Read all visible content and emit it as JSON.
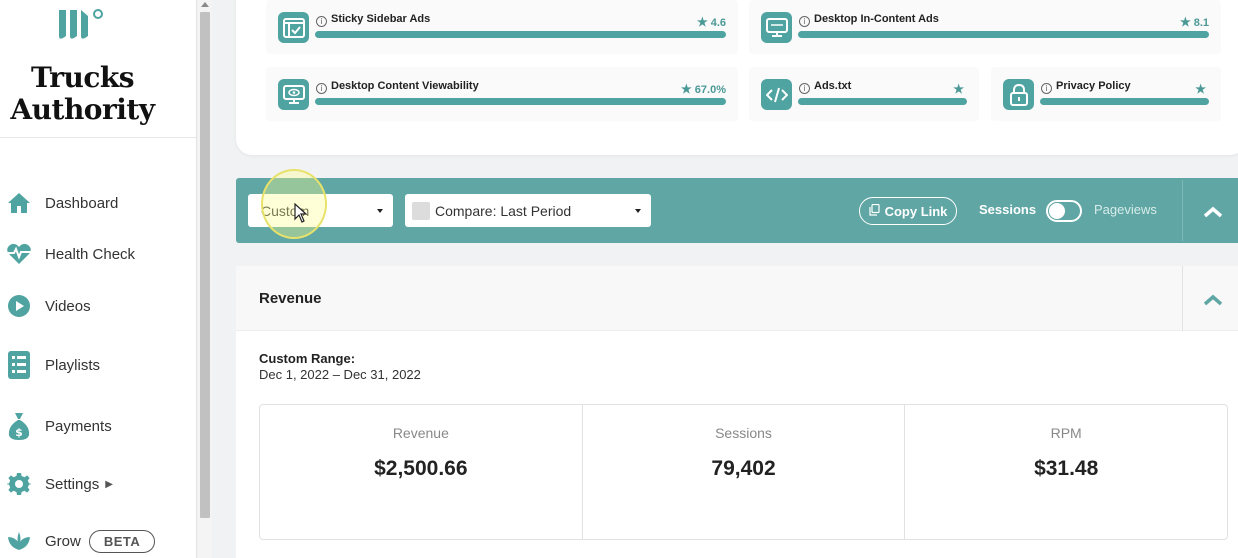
{
  "brand": {
    "line1": "Trucks",
    "line2": "Authority"
  },
  "sidebar": {
    "items": [
      {
        "label": "Dashboard",
        "icon": "home-icon"
      },
      {
        "label": "Health Check",
        "icon": "heartbeat-icon"
      },
      {
        "label": "Videos",
        "icon": "play-icon"
      },
      {
        "label": "Playlists",
        "icon": "list-icon"
      },
      {
        "label": "Payments",
        "icon": "money-bag-icon"
      },
      {
        "label": "Settings",
        "icon": "gear-icon"
      },
      {
        "label": "Grow",
        "icon": "leaf-icon",
        "badge": "BETA"
      }
    ]
  },
  "metrics": [
    {
      "title": "Sticky Sidebar Ads",
      "score": "4.6",
      "icon": "sidebar-window-icon"
    },
    {
      "title": "Desktop In-Content Ads",
      "score": "8.1",
      "icon": "desktop-monitor-icon"
    },
    {
      "title": "Desktop Content Viewability",
      "score": "67.0%",
      "icon": "monitor-eye-icon"
    },
    {
      "title": "Ads.txt",
      "score": "",
      "icon": "code-icon"
    },
    {
      "title": "Privacy Policy",
      "score": "",
      "icon": "lock-icon"
    }
  ],
  "filters": {
    "range_value": "Custom",
    "compare_value": "Compare: Last Period",
    "copy_link": "Copy Link",
    "sessions": "Sessions",
    "pageviews": "Pageviews"
  },
  "revenue": {
    "title": "Revenue",
    "range_label": "Custom Range:",
    "range_value": "Dec 1, 2022 – Dec 31, 2022",
    "stats": [
      {
        "label": "Revenue",
        "value": "$2,500.66"
      },
      {
        "label": "Sessions",
        "value": "79,402"
      },
      {
        "label": "RPM",
        "value": "$31.48"
      }
    ]
  },
  "colors": {
    "accent": "#5fa6a4",
    "icon_bg": "#4fa3a0",
    "score": "#4a9996"
  }
}
